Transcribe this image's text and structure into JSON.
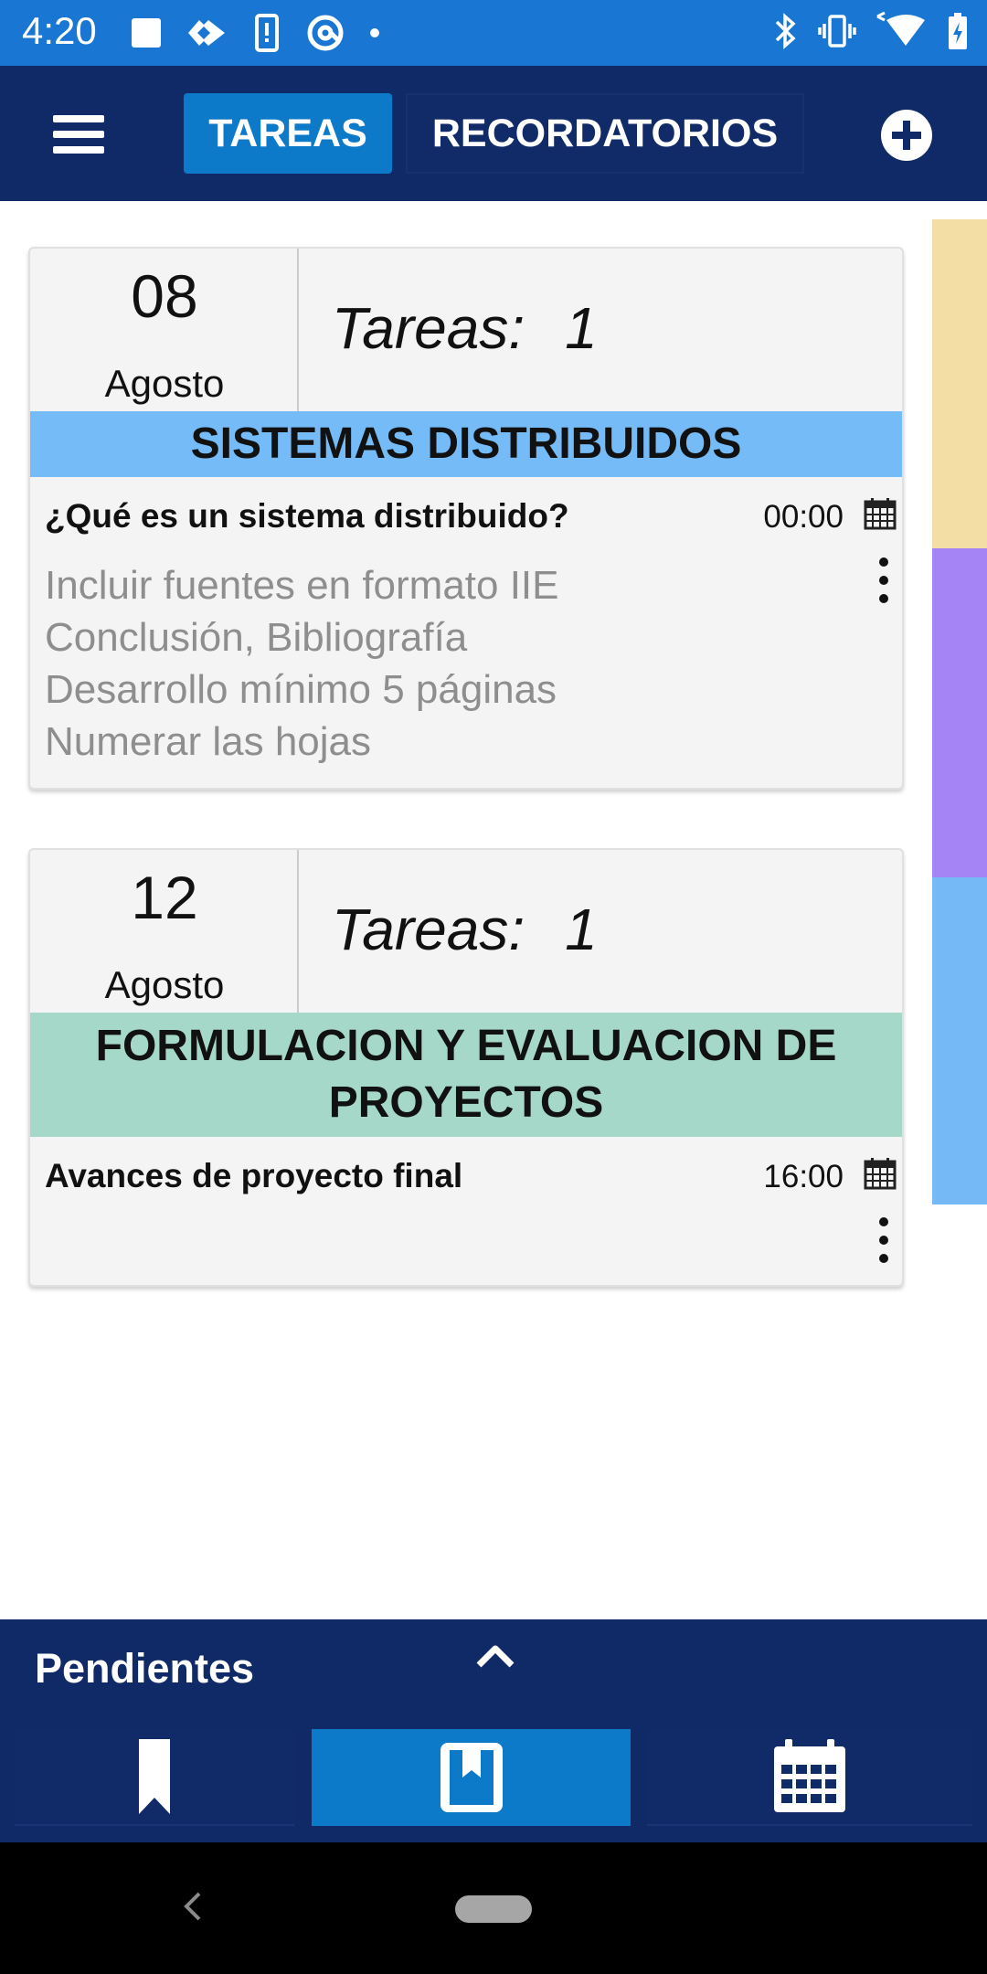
{
  "status_bar": {
    "time": "4:20",
    "left_icons": [
      "stop-square-icon",
      "diamond-arrow-icon",
      "phone-alert-icon",
      "at-sign-icon",
      "dot-icon"
    ],
    "right_icons": [
      "bluetooth-icon",
      "vibrate-icon",
      "wifi-icon",
      "battery-charging-icon"
    ]
  },
  "app_bar": {
    "menu_icon": "hamburger-menu-icon",
    "tabs": [
      {
        "label": "TAREAS",
        "active": true
      },
      {
        "label": "RECORDATORIOS",
        "active": false
      }
    ],
    "add_icon": "add-circle-icon"
  },
  "side_strip_colors": [
    "#f3dfa6",
    "#a585f5",
    "#75baf7"
  ],
  "cards": [
    {
      "day": "08",
      "month": "Agosto",
      "count_label": "Tareas:",
      "count": "1",
      "subject": "SISTEMAS DISTRIBUIDOS",
      "subject_color": "#74bbf7",
      "task": {
        "title": "¿Qué es un sistema distribuido?",
        "time": "00:00",
        "description": [
          "Incluir fuentes en formato IIE",
          "Conclusión, Bibliografía",
          "Desarrollo mínimo 5 páginas",
          "Numerar las hojas"
        ]
      }
    },
    {
      "day": "12",
      "month": "Agosto",
      "count_label": "Tareas:",
      "count": "1",
      "subject_line1": "FORMULACION Y EVALUACION DE",
      "subject_line2": "PROYECTOS",
      "subject_color": "#a5d8c8",
      "task": {
        "title": "Avances de proyecto final",
        "time": "16:00"
      }
    }
  ],
  "bottom_panel": {
    "label": "Pendientes",
    "expand_icon": "chevron-up-icon",
    "nav": [
      {
        "icon": "bookmark-icon",
        "active": false
      },
      {
        "icon": "book-icon",
        "active": true
      },
      {
        "icon": "calendar-icon",
        "active": false
      }
    ]
  },
  "colors": {
    "status_bar": "#1976d2",
    "app_bar": "#0f2a66",
    "accent": "#0d79c9"
  }
}
